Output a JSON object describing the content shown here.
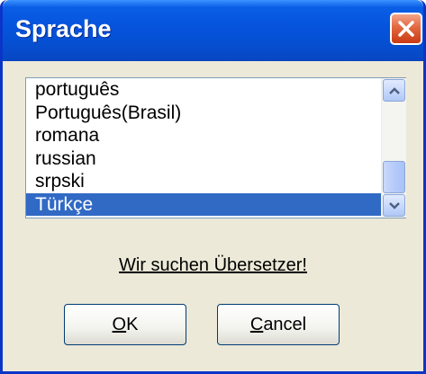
{
  "window": {
    "title": "Sprache"
  },
  "language_list": {
    "items": [
      {
        "label": "português",
        "selected": false
      },
      {
        "label": "Português(Brasil)",
        "selected": false
      },
      {
        "label": "romana",
        "selected": false
      },
      {
        "label": "russian",
        "selected": false
      },
      {
        "label": "srpski",
        "selected": false
      },
      {
        "label": "Türkçe",
        "selected": true
      }
    ]
  },
  "link": {
    "text": "Wir suchen Übersetzer!"
  },
  "buttons": {
    "ok": {
      "mnemonic": "O",
      "rest": "K"
    },
    "cancel": {
      "mnemonic": "C",
      "rest": "ancel"
    }
  },
  "colors": {
    "selection": "#316ac5",
    "titlebar": "#0653dc",
    "close": "#e2673f"
  }
}
